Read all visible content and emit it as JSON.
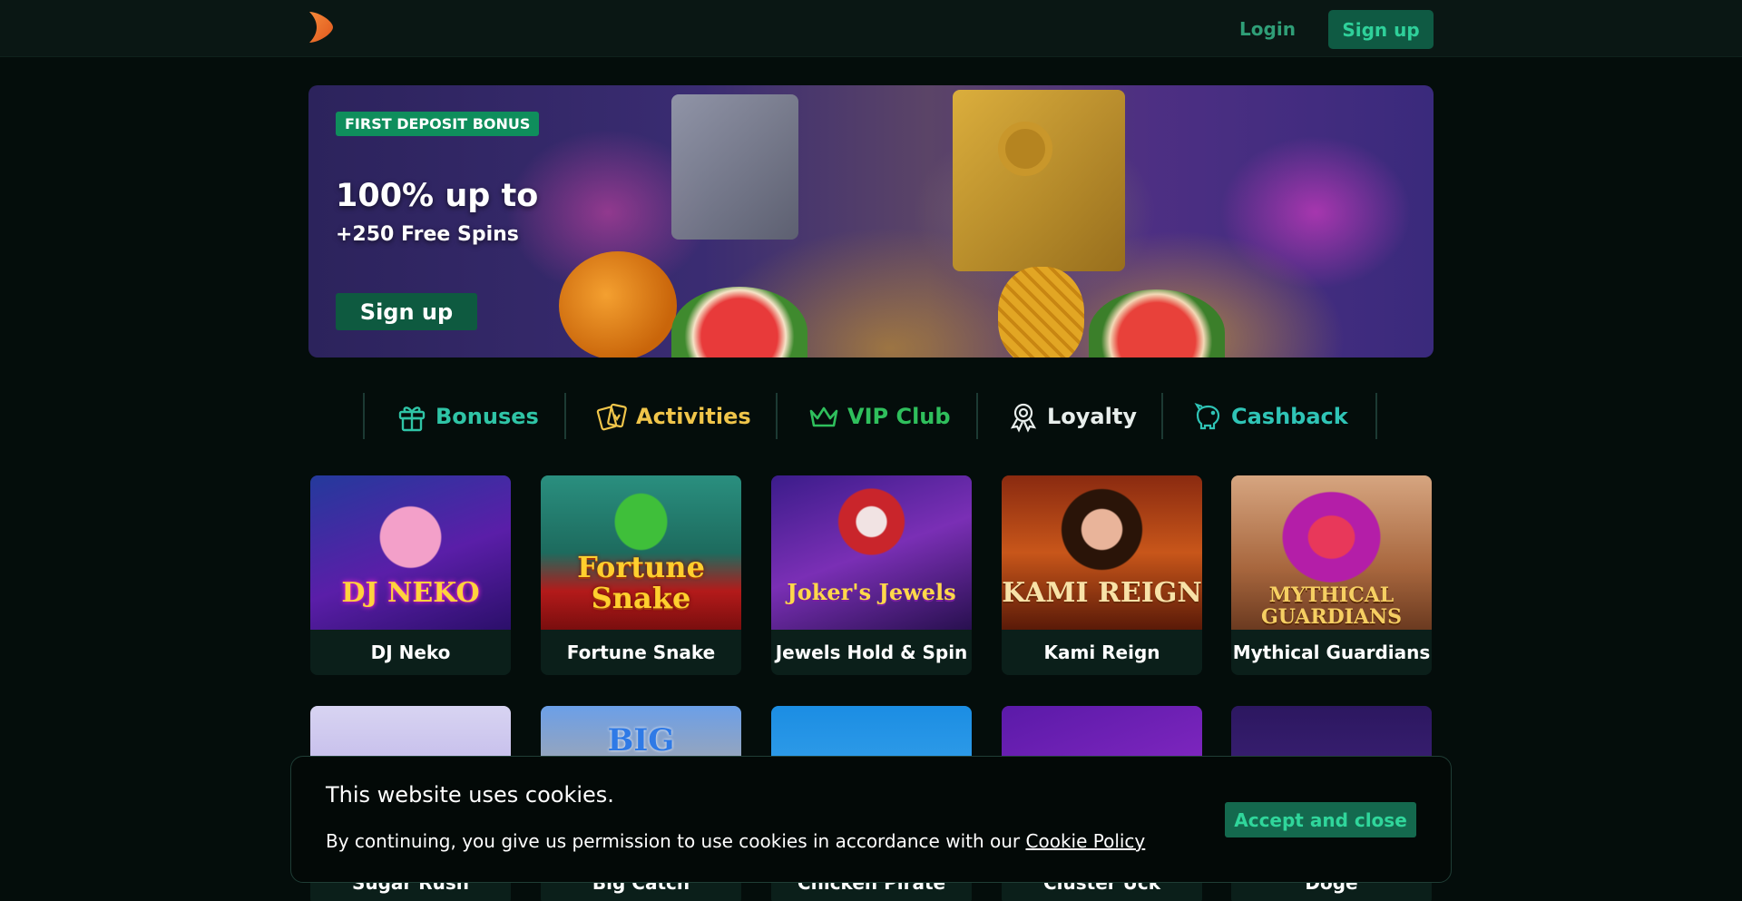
{
  "header": {
    "logo_icon": "chevron-logo-icon",
    "login_label": "Login",
    "signup_label": "Sign up"
  },
  "banner": {
    "badge": "FIRST DEPOSIT BONUS",
    "title": "100% up to",
    "subtitle": "+250 Free Spins",
    "cta": "Sign up"
  },
  "categories": [
    {
      "label": "Bonuses",
      "icon": "gift-icon",
      "color": "#2fc4a6"
    },
    {
      "label": "Activities",
      "icon": "cards-icon",
      "color": "#f0c54a"
    },
    {
      "label": "VIP Club",
      "icon": "crown-icon",
      "color": "#2fbf5c"
    },
    {
      "label": "Loyalty",
      "icon": "ribbon-badge-icon",
      "color": "#e8eeec"
    },
    {
      "label": "Cashback",
      "icon": "piggy-bank-icon",
      "color": "#2fc4b6"
    }
  ],
  "games_row1": [
    {
      "title": "DJ Neko",
      "art": "DJ NEKO"
    },
    {
      "title": "Fortune Snake",
      "art": "Fortune Snake"
    },
    {
      "title": "Jewels Hold & Spin",
      "art": "Joker's Jewels"
    },
    {
      "title": "Kami Reign",
      "art": "KAMI REIGN"
    },
    {
      "title": "Mythical Guardians",
      "art": "MYTHICAL GUARDIANS"
    }
  ],
  "games_row2": [
    {
      "title": "Sugar Rush"
    },
    {
      "title": "Big Catch",
      "art": "BIG"
    },
    {
      "title": "Chicken Pirate"
    },
    {
      "title": "Cluster Uck"
    },
    {
      "title": "Doge"
    }
  ],
  "cookie": {
    "title": "This website uses cookies.",
    "text": "By continuing, you give us permission to use cookies in accordance with our ",
    "link": "Cookie Policy",
    "accept": "Accept and close"
  },
  "colors": {
    "accent": "#0f5a43",
    "accent_text": "#2fd09a",
    "background": "#040d0b"
  }
}
